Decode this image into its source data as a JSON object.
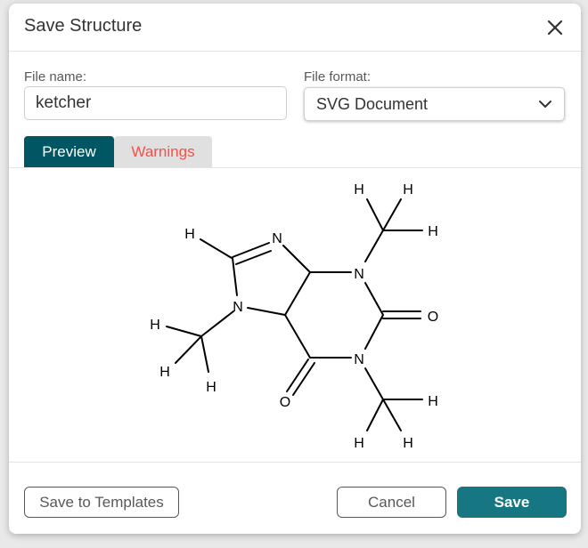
{
  "dialog": {
    "title": "Save Structure",
    "close_icon": "close-icon"
  },
  "file_name": {
    "label": "File name:",
    "value": "ketcher"
  },
  "file_format": {
    "label": "File format:",
    "selected": "SVG Document",
    "chevron_icon": "chevron-down-icon"
  },
  "tabs": [
    {
      "label": "Preview",
      "active": true
    },
    {
      "label": "Warnings",
      "active": false
    }
  ],
  "molecule": {
    "atom_labels": [
      "H",
      "H",
      "H",
      "H",
      "N",
      "N",
      "O",
      "H",
      "N",
      "N",
      "H",
      "H",
      "O",
      "H",
      "H",
      "H"
    ]
  },
  "buttons": {
    "save_to_templates": "Save to Templates",
    "cancel": "Cancel",
    "save": "Save"
  },
  "colors": {
    "accent": "#005662",
    "save_button": "#167782",
    "warnings_text": "#f5504a"
  }
}
